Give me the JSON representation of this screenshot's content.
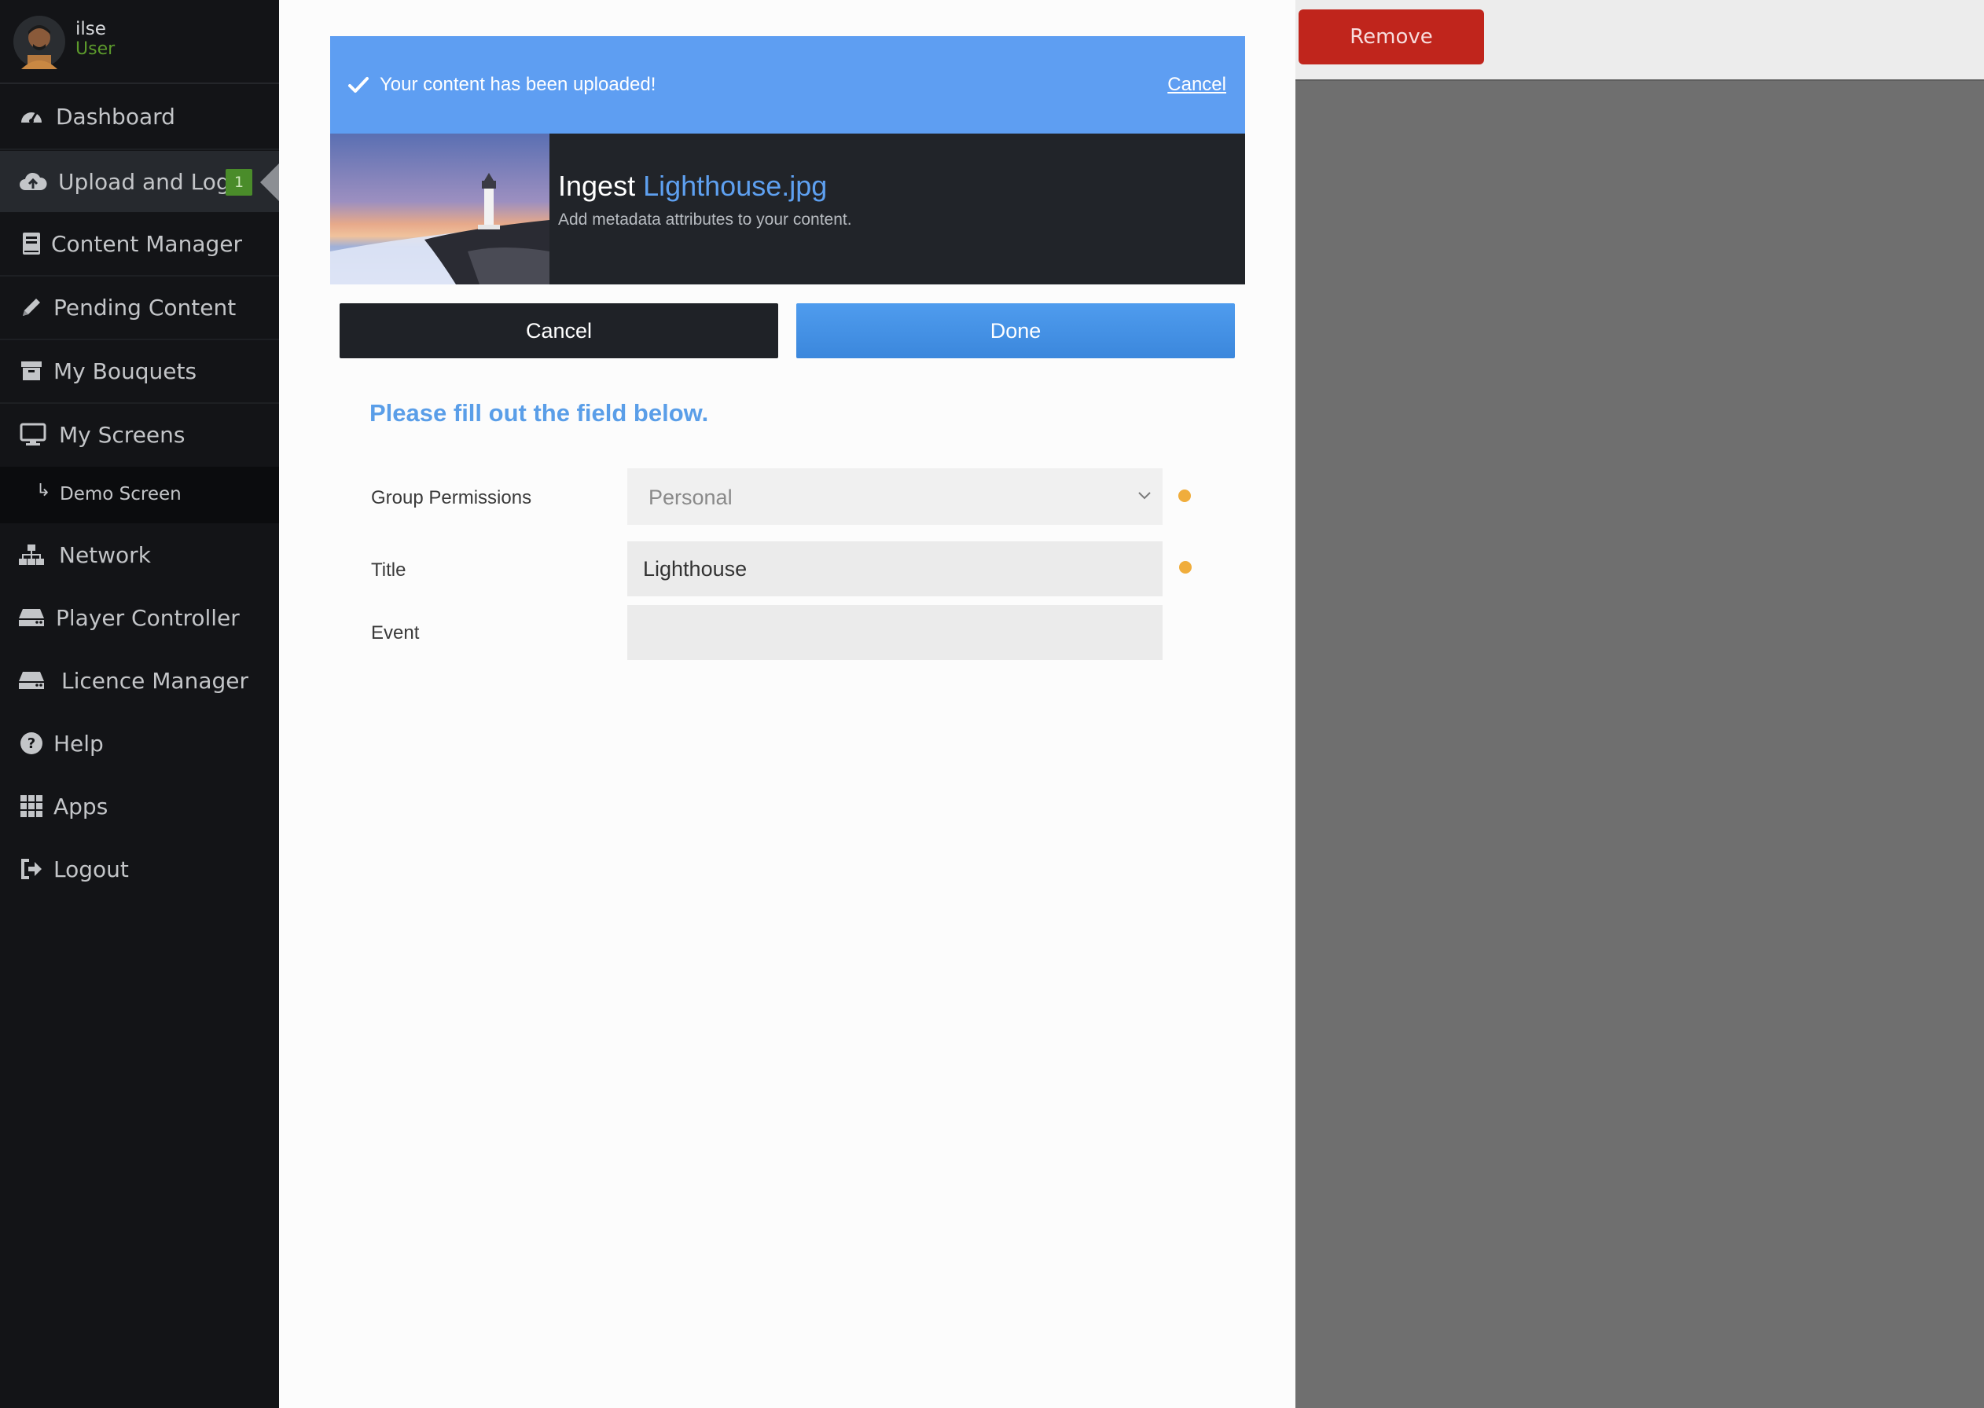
{
  "sidebar": {
    "profile": {
      "name": "ilse",
      "role": "User"
    },
    "items": [
      {
        "label": "Dashboard",
        "icon": "dashboard-icon"
      },
      {
        "label": "Upload and Log",
        "icon": "cloud-upload-icon",
        "badge": "1",
        "active": true
      },
      {
        "label": "Content Manager",
        "icon": "book-icon"
      },
      {
        "label": "Pending Content",
        "icon": "pencil-icon"
      },
      {
        "label": "My Bouquets",
        "icon": "archive-icon"
      },
      {
        "label": "My Screens",
        "icon": "monitor-icon"
      },
      {
        "label": "Network",
        "icon": "sitemap-icon"
      },
      {
        "label": "Player Controller",
        "icon": "hdd-icon"
      },
      {
        "label": "Licence Manager",
        "icon": "hdd-icon"
      },
      {
        "label": "Help",
        "icon": "question-circle-icon"
      },
      {
        "label": "Apps",
        "icon": "grid-icon"
      },
      {
        "label": "Logout",
        "icon": "sign-out-icon"
      }
    ],
    "sub_item": {
      "label": "Demo Screen",
      "icon": "return-arrow-icon"
    }
  },
  "topbar": {
    "remove_label": "Remove"
  },
  "modal": {
    "banner": {
      "message": "Your content has been uploaded!",
      "cancel_label": "Cancel"
    },
    "ingest": {
      "prefix": "Ingest",
      "filename": "Lighthouse.jpg",
      "subtitle": "Add metadata attributes to your content."
    },
    "cancel_label": "Cancel",
    "done_label": "Done",
    "prompt": "Please fill out the field below.",
    "form": {
      "group_permissions": {
        "label": "Group Permissions",
        "value": "Personal"
      },
      "title": {
        "label": "Title",
        "value": "Lighthouse"
      },
      "event": {
        "label": "Event",
        "value": ""
      }
    }
  },
  "colors": {
    "sidebar_bg": "#131417",
    "banner": "#5e9ef2",
    "accent_blue": "#5a9ee8",
    "remove_red": "#c0251c",
    "required_dot": "#f0ad3c",
    "badge_green": "#4a8c2a"
  }
}
